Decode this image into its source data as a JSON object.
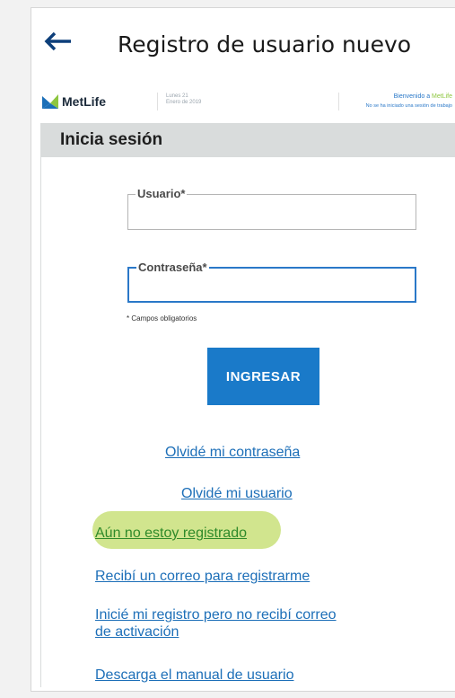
{
  "header": {
    "title": "Registro de usuario nuevo",
    "back_icon": "back-arrow-icon"
  },
  "brand": {
    "logo_text": "MetLife",
    "date_line1": "Lunes 21",
    "date_line2": "Enero de 2019",
    "welcome_prefix": "Bienvenido a ",
    "welcome_brand": "MetLife",
    "session_note": "No se ha iniciado una sesión de trabajo",
    "colors": {
      "logo_blue": "#1b6fb8",
      "logo_green": "#8dc63f"
    }
  },
  "login": {
    "section_title": "Inicia sesión",
    "username_label": "Usuario*",
    "username_value": "",
    "password_label": "Contraseña*",
    "password_value": "",
    "required_note": "* Campos obligatorios",
    "submit_label": "INGRESAR"
  },
  "links": {
    "forgot_password": "Olvidé mi contraseña",
    "forgot_user": "Olvidé mi usuario",
    "not_registered": "Aún no estoy registrado",
    "received_email": "Recibí un correo para registrarme",
    "no_activation_line1": "Inicié mi registro pero no recibí correo",
    "no_activation_line2": "de activación",
    "download_manual": "Descarga el manual de usuario"
  },
  "colors": {
    "accent": "#1a7ac9",
    "link": "#1d6fb8",
    "highlight": "#c9e07a",
    "section_bg": "#d9dcdc"
  }
}
